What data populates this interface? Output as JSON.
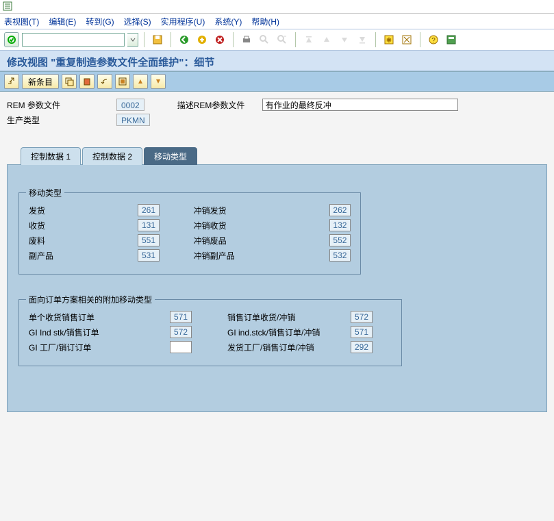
{
  "menu": {
    "view": "表视图(T)",
    "edit": "编辑(E)",
    "goto": "转到(G)",
    "select": "选择(S)",
    "utilities": "实用程序(U)",
    "system": "系统(Y)",
    "help": "帮助(H)"
  },
  "title": "修改视图 \"重复制造参数文件全面维护\"：细节",
  "toolbar2": {
    "new_entry": "新条目"
  },
  "header": {
    "rem_profile_label": "REM 参数文件",
    "rem_profile_value": "0002",
    "prod_type_label": "生产类型",
    "prod_type_value": "PKMN",
    "desc_label": "描述REM参数文件",
    "desc_value": "有作业的最终反冲"
  },
  "tabs": {
    "ctrl1": "控制数据 1",
    "ctrl2": "控制数据 2",
    "mvt": "移动类型"
  },
  "group1": {
    "title": "移动类型",
    "rows": [
      {
        "l1": "发货",
        "v1": "261",
        "l2": "冲销发货",
        "v2": "262"
      },
      {
        "l1": "收货",
        "v1": "131",
        "l2": "冲销收货",
        "v2": "132"
      },
      {
        "l1": "废料",
        "v1": "551",
        "l2": "冲销废品",
        "v2": "552"
      },
      {
        "l1": "副产品",
        "v1": "531",
        "l2": "冲销副产品",
        "v2": "532"
      }
    ]
  },
  "group2": {
    "title": "面向订单方案相关的附加移动类型",
    "rows": [
      {
        "l1": "单个收货销售订单",
        "v1": "571",
        "l2": "销售订单收货/冲销",
        "v2": "572"
      },
      {
        "l1": "GI Ind stk/销售订单",
        "v1": "572",
        "l2": "GI ind.stck/销售订单/冲销",
        "v2": "571"
      },
      {
        "l1": "GI 工厂/销订订单",
        "v1": "",
        "l2": "发货工厂/销售订单/冲销",
        "v2": "292"
      }
    ]
  }
}
